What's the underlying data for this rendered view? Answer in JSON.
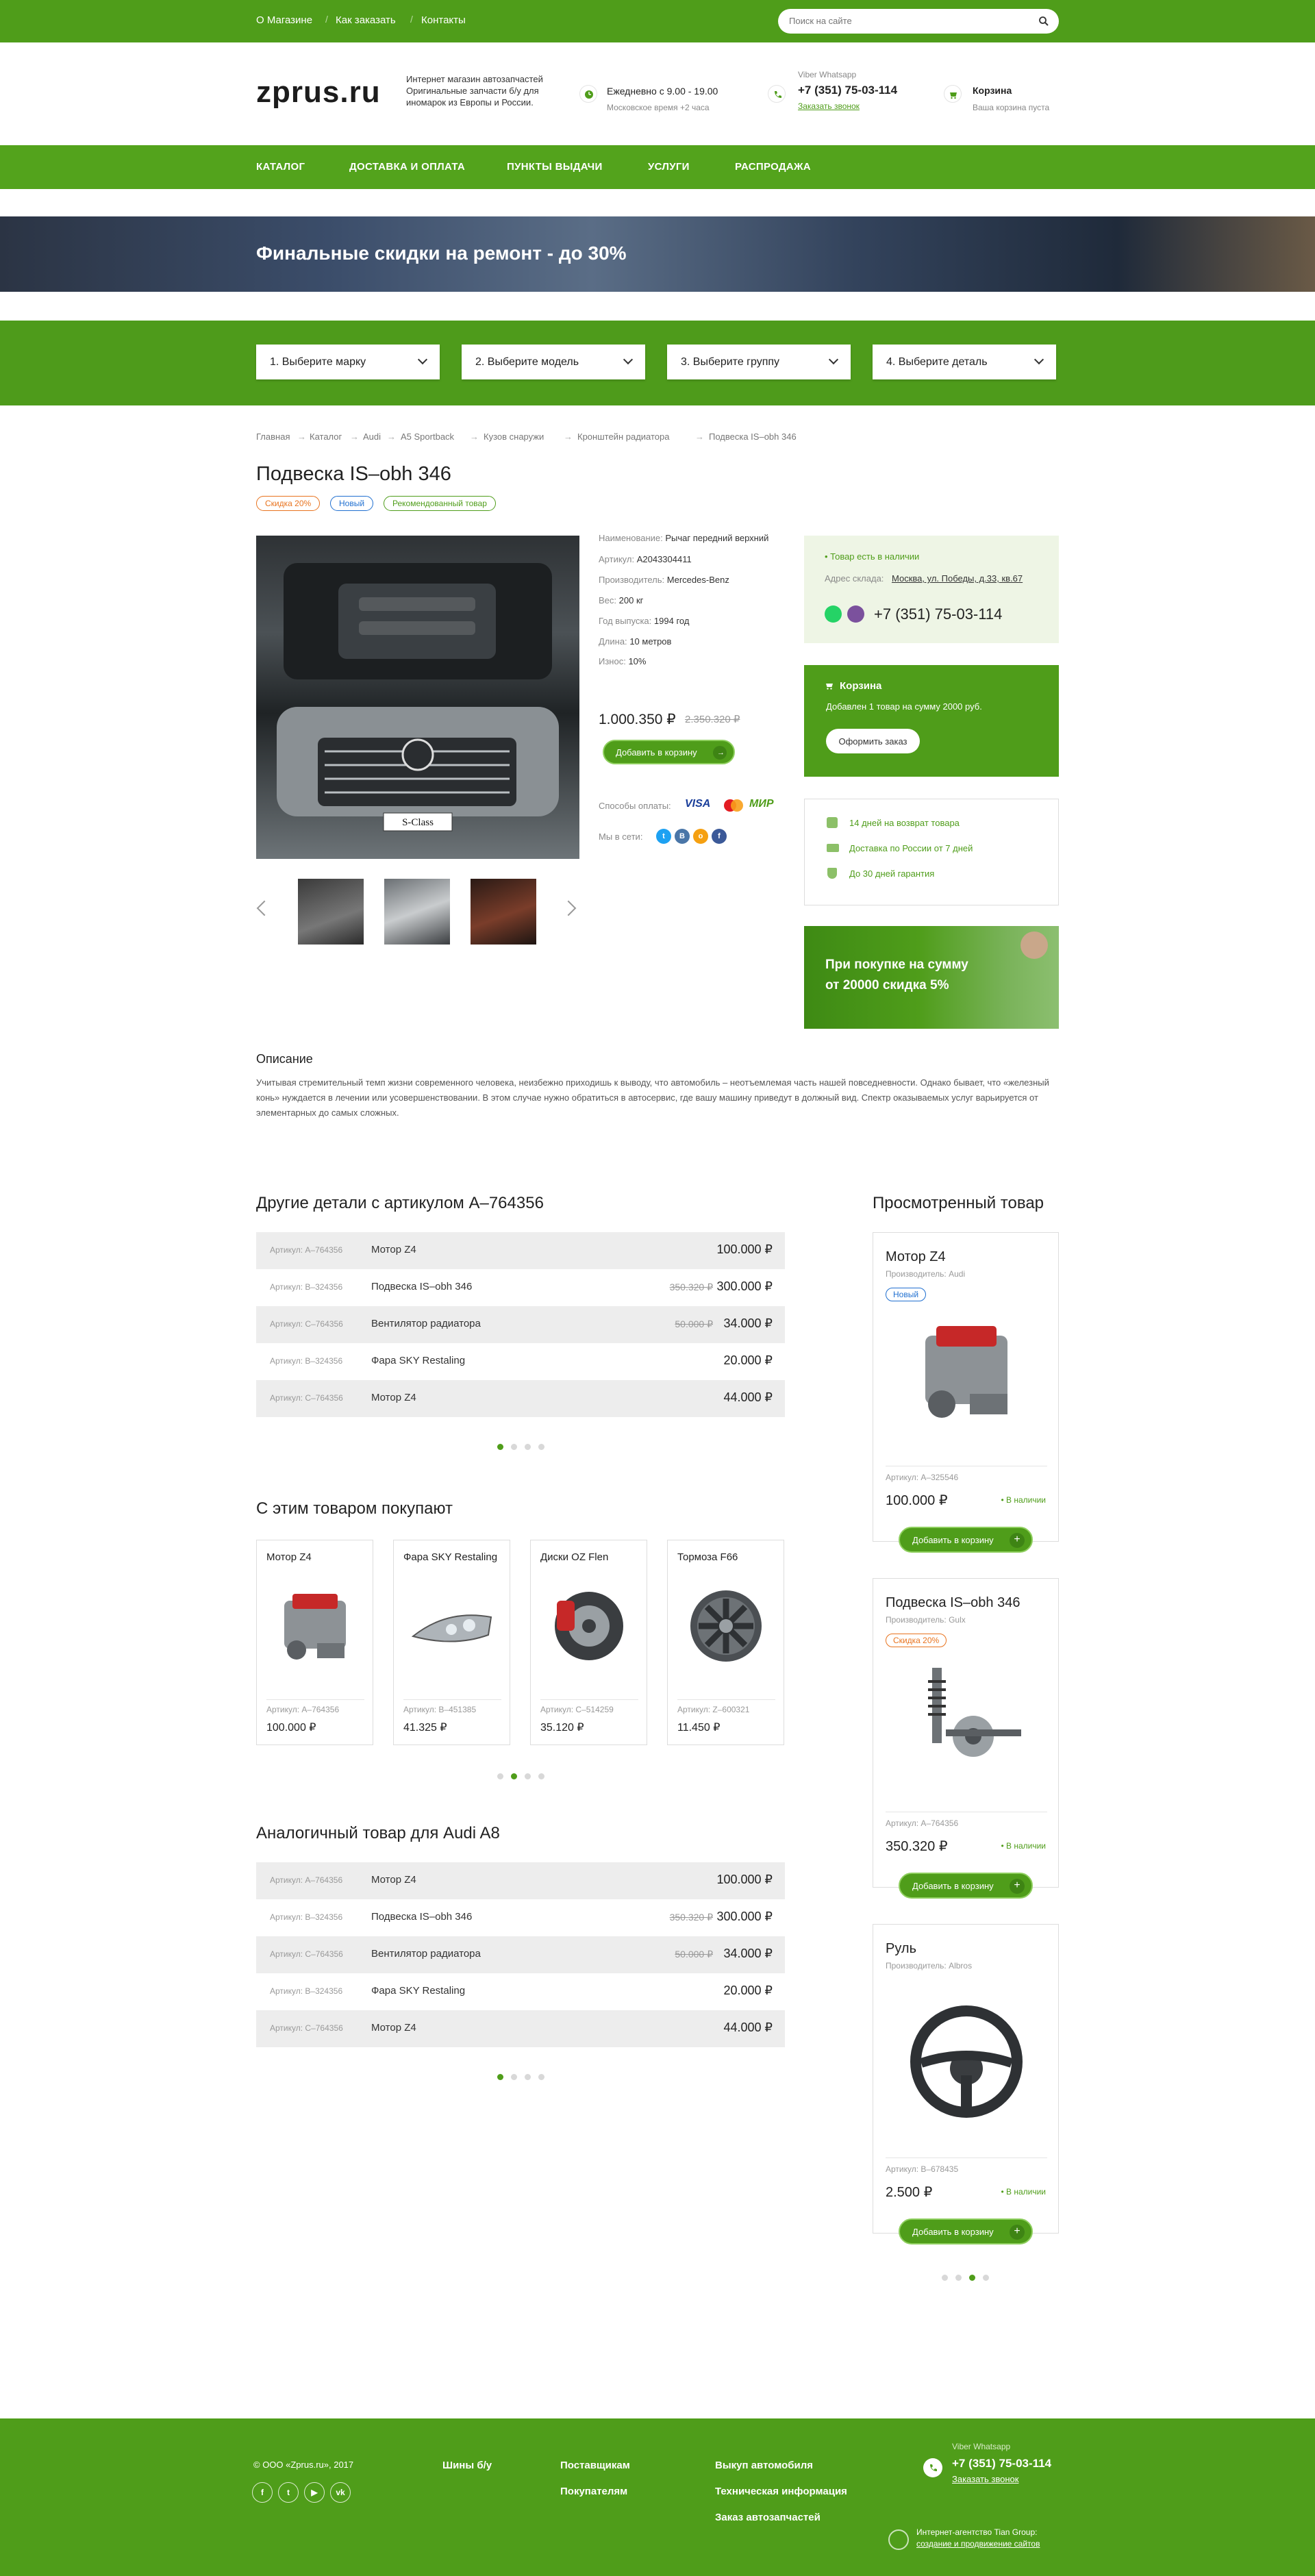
{
  "header": {
    "toplinks": [
      "О Магазине",
      "Как заказать",
      "Контакты"
    ],
    "search_placeholder": "Поиск на сайте",
    "logo": "zprus.ru",
    "tagline": "Интернет магазин автозапчастей Оригинальные запчасти б/у для иномарок из Европы и России.",
    "hours_title": "Ежедневно с 9.00 - 19.00",
    "hours_sub": "Московское время +2 часа",
    "messengers": "Viber   Whatsapp",
    "phone": "+7 (351) 75-03-114",
    "callback": "Заказать звонок",
    "cart_title": "Корзина",
    "cart_sub": "Ваша корзина пуста"
  },
  "nav": [
    "КАТАЛОГ",
    "ДОСТАВКА И ОПЛАТА",
    "ПУНКТЫ ВЫДАЧИ",
    "УСЛУГИ",
    "РАСПРОДАЖА"
  ],
  "banner": {
    "title": "Финальные скидки на ремонт - до 30%"
  },
  "filters": [
    "1. Выберите марку",
    "2. Выберите модель",
    "3. Выберите группу",
    "4. Выберите деталь"
  ],
  "breadcrumbs": [
    "Главная",
    "Каталог",
    "Audi",
    "A5 Sportback",
    "Кузов снаружи",
    "Кронштейн радиатора",
    "Подвеска IS–obh 346"
  ],
  "product": {
    "title": "Подвеска IS–obh 346",
    "tags": [
      "Скидка 20%",
      "Новый",
      "Рекомендованный товар"
    ],
    "tag_colors": [
      "#e8731e",
      "#1f6fd0",
      "#4f9d1a"
    ],
    "image_caption": "S-Class",
    "specs": [
      {
        "label": "Наименование:",
        "value": "Рычаг передний верхний"
      },
      {
        "label": "Артикул:",
        "value": "A2043304411"
      },
      {
        "label": "Производитель:",
        "value": "Mercedes-Benz"
      },
      {
        "label": "Вес:",
        "value": "200 кг"
      },
      {
        "label": "Год выпуска:",
        "value": "1994 год"
      },
      {
        "label": "Длина:",
        "value": "10 метров"
      },
      {
        "label": "Износ:",
        "value": "10%"
      }
    ],
    "price": "1.000.350 ₽",
    "old_price": "2.350.320 ₽",
    "add_to_cart": "Добавить в корзину",
    "payment_label": "Способы оплаты:",
    "payment_methods": [
      "VISA",
      "МИР"
    ],
    "social_label": "Мы в сети:",
    "socials": [
      "t",
      "В",
      "о",
      "f"
    ]
  },
  "stock": {
    "status": "• Товар есть в наличии",
    "address_label": "Адрес склада:",
    "address": "Москва, ул. Победы, д.33, кв.67",
    "phone": "+7 (351) 75-03-114"
  },
  "cart_box": {
    "title": "Корзина",
    "text": "Добавлен 1 товар на сумму 2000 руб.",
    "button": "Оформить заказ"
  },
  "benefits": [
    "14 дней на возврат товара",
    "Доставка по России от 7 дней",
    "До 30 дней гарантия"
  ],
  "promo": {
    "line1": "При покупке на сумму",
    "line2": "от 20000 скидка 5%"
  },
  "description": {
    "heading": "Описание",
    "text": "Учитывая стремительный темп жизни современного человека, неизбежно приходишь к выводу, что автомобиль – неотъемлемая часть нашей повседневности. Однако бывает, что «железный конь» нуждается в лечении или усовершенствовании. В этом случае нужно обратиться в автосервис, где вашу машину приведут в должный вид. Спектр оказываемых услуг варьируется от элементарных до самых сложных."
  },
  "other_parts": {
    "heading": "Другие детали с артикулом A–764356",
    "rows": [
      {
        "art": "Артикул: A–764356",
        "name": "Мотор Z4",
        "old": "",
        "price": "100.000 ₽"
      },
      {
        "art": "Артикул: B–324356",
        "name": "Подвеска IS–obh 346",
        "old": "350.320 ₽",
        "price": "300.000 ₽"
      },
      {
        "art": "Артикул: C–764356",
        "name": "Вентилятор радиатора",
        "old": "50.000 ₽",
        "price": "34.000 ₽"
      },
      {
        "art": "Артикул: B–324356",
        "name": "Фара SKY Restaling",
        "old": "",
        "price": "20.000 ₽"
      },
      {
        "art": "Артикул: C–764356",
        "name": "Мотор Z4",
        "old": "",
        "price": "44.000 ₽"
      }
    ]
  },
  "bought_with": {
    "heading": "С этим товаром покупают",
    "cards": [
      {
        "title": "Мотор Z4",
        "art": "Артикул: A–764356",
        "price": "100.000 ₽"
      },
      {
        "title": "Фара SKY Restaling",
        "art": "Артикул: B–451385",
        "price": "41.325 ₽"
      },
      {
        "title": "Диски OZ Flen",
        "art": "Артикул: C–514259",
        "price": "35.120 ₽"
      },
      {
        "title": "Тормоза F66",
        "art": "Артикул: Z–600321",
        "price": "11.450 ₽"
      }
    ]
  },
  "analog": {
    "heading": "Аналогичный товар для Audi A8",
    "rows": [
      {
        "art": "Артикул: A–764356",
        "name": "Мотор Z4",
        "old": "",
        "price": "100.000 ₽"
      },
      {
        "art": "Артикул: B–324356",
        "name": "Подвеска IS–obh 346",
        "old": "350.320 ₽",
        "price": "300.000 ₽"
      },
      {
        "art": "Артикул: C–764356",
        "name": "Вентилятор радиатора",
        "old": "50.000 ₽",
        "price": "34.000 ₽"
      },
      {
        "art": "Артикул: B–324356",
        "name": "Фара SKY Restaling",
        "old": "",
        "price": "20.000 ₽"
      },
      {
        "art": "Артикул: C–764356",
        "name": "Мотор Z4",
        "old": "",
        "price": "44.000 ₽"
      }
    ]
  },
  "viewed": {
    "heading": "Просмотренный товар",
    "items": [
      {
        "title": "Мотор Z4",
        "maker": "Производитель: Audi",
        "tag": "Новый",
        "art": "Артикул: A–325546",
        "price": "100.000 ₽",
        "stock": "• В наличии",
        "button": "Добавить в корзину"
      },
      {
        "title": "Подвеска IS–obh 346",
        "maker": "Производитель: Gulx",
        "tag": "Скидка 20%",
        "art": "Артикул: A–764356",
        "price": "350.320 ₽",
        "stock": "• В наличии",
        "button": "Добавить в корзину"
      },
      {
        "title": "Руль",
        "maker": "Производитель: Albros",
        "tag": "",
        "art": "Артикул: B–678435",
        "price": "2.500 ₽",
        "stock": "• В наличии",
        "button": "Добавить в корзину"
      }
    ]
  },
  "footer": {
    "copyright": "© ООО «Zprus.ru», 2017",
    "col1": [
      "Шины б/у"
    ],
    "col2": [
      "Поставщикам",
      "Покупателям"
    ],
    "col3": [
      "Выкуп автомобиля",
      "Техническая информация",
      "Заказ автозапчастей"
    ],
    "messengers": "Viber   Whatsapp",
    "phone": "+7 (351) 75-03-114",
    "callback": "Заказать звонок",
    "agency": "Интернет-агентство Tian Group:",
    "agency_link": "создание и продвижение сайтов",
    "socials": [
      "f",
      "t",
      "▶",
      "vk"
    ]
  },
  "colors": {
    "brand_green": "#4f9d1a",
    "light_green": "#eef5e5",
    "orange": "#e8731e",
    "blue": "#1f6fd0"
  }
}
